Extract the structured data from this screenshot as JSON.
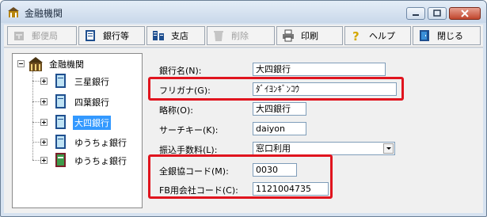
{
  "window": {
    "title": "金融機関"
  },
  "toolbar": {
    "buttons": [
      {
        "label": "郵便局",
        "enabled": false
      },
      {
        "label": "銀行等",
        "enabled": true
      },
      {
        "label": "支店",
        "enabled": true
      },
      {
        "label": "削除",
        "enabled": false
      },
      {
        "label": "印刷",
        "enabled": true
      },
      {
        "label": "ヘルプ",
        "enabled": true
      },
      {
        "label": "閉じる",
        "enabled": true
      }
    ]
  },
  "tree": {
    "root": "金融機関",
    "children": [
      {
        "label": "三星銀行",
        "selected": false
      },
      {
        "label": "四葉銀行",
        "selected": false
      },
      {
        "label": "大四銀行",
        "selected": true
      },
      {
        "label": "ゆうちょ銀行",
        "selected": false
      },
      {
        "label": "ゆうちょ銀行",
        "selected": false
      }
    ]
  },
  "form": {
    "bank_name_label": "銀行名(N):",
    "bank_name_value": "大四銀行",
    "furigana_label": "フリガナ(G):",
    "furigana_value": "ﾀﾞｲﾖﾝｷﾞﾝｺｳ",
    "short_name_label": "略称(O):",
    "short_name_value": "大四銀行",
    "search_key_label": "サーチキー(K):",
    "search_key_value": "daiyon",
    "fee_label": "振込手数料(L):",
    "fee_value": "窓口利用",
    "zengin_code_label": "全銀協コード(M):",
    "zengin_code_value": "0030",
    "fb_code_label": "FB用会社コード(C):",
    "fb_code_value": "1121004735"
  },
  "colors": {
    "highlight": "#e0141e",
    "selection": "#3399ff",
    "title_bar": "#d6e2f0"
  },
  "icons": [
    "app-icon",
    "post-office-icon",
    "bank-book-icon",
    "branch-icon",
    "delete-icon",
    "print-icon",
    "help-icon",
    "close-door-icon",
    "bank-building-icon"
  ]
}
